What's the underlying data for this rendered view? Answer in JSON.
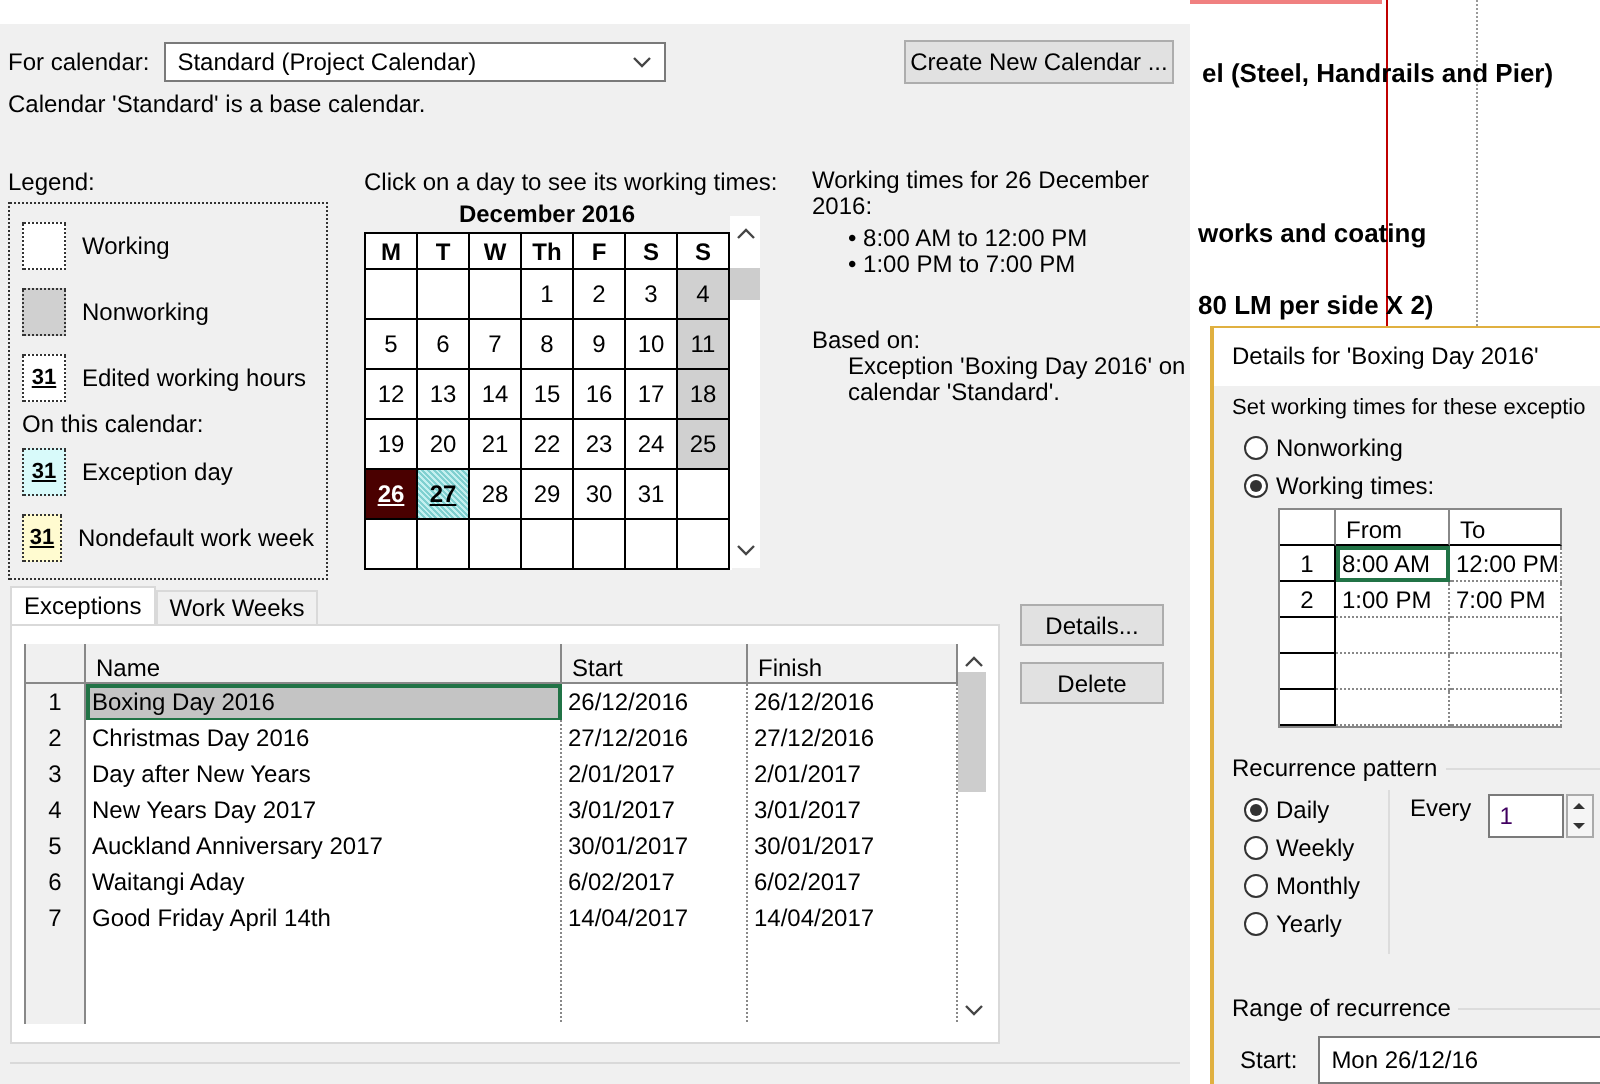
{
  "gantt_background": {
    "texts": [
      "el (Steel, Handrails and Pier)",
      "works and coating",
      "80 LM per side X 2)"
    ]
  },
  "calendar_dialog": {
    "calendar_label": "For calendar:",
    "calendar_value": "Standard (Project Calendar)",
    "create_button": "Create New Calendar ...",
    "base_note": "Calendar 'Standard' is a base calendar.",
    "legend": {
      "label": "Legend:",
      "items": [
        {
          "kind": "working",
          "label": "Working"
        },
        {
          "kind": "nonworking",
          "label": "Nonworking"
        },
        {
          "kind": "edited",
          "sample": "31",
          "label": "Edited working hours"
        }
      ],
      "section": "On this calendar:",
      "calendar_items": [
        {
          "kind": "exception",
          "sample": "31",
          "label": "Exception day"
        },
        {
          "kind": "nondefault",
          "sample": "31",
          "label": "Nondefault work week"
        }
      ]
    },
    "calendar": {
      "prompt": "Click on a day to see its working times:",
      "month": "December 2016",
      "weekdays": [
        "M",
        "T",
        "W",
        "Th",
        "F",
        "S",
        "S"
      ],
      "weeks": [
        [
          {
            "kind": "blank",
            "selected": false
          },
          {
            "kind": "blank",
            "selected": false
          },
          {
            "kind": "blank",
            "selected": false
          },
          {
            "day": "1",
            "kind": "working",
            "selected": false
          },
          {
            "day": "2",
            "kind": "working",
            "selected": false
          },
          {
            "day": "3",
            "kind": "working",
            "selected": false
          },
          {
            "day": "4",
            "kind": "nonworking",
            "selected": false
          }
        ],
        [
          {
            "day": "5",
            "kind": "working",
            "selected": false
          },
          {
            "day": "6",
            "kind": "working",
            "selected": false
          },
          {
            "day": "7",
            "kind": "working",
            "selected": false
          },
          {
            "day": "8",
            "kind": "working",
            "selected": false
          },
          {
            "day": "9",
            "kind": "working",
            "selected": false
          },
          {
            "day": "10",
            "kind": "working",
            "selected": false
          },
          {
            "day": "11",
            "kind": "nonworking",
            "selected": false
          }
        ],
        [
          {
            "day": "12",
            "kind": "working",
            "selected": false
          },
          {
            "day": "13",
            "kind": "working",
            "selected": false
          },
          {
            "day": "14",
            "kind": "working",
            "selected": false
          },
          {
            "day": "15",
            "kind": "working",
            "selected": false
          },
          {
            "day": "16",
            "kind": "working",
            "selected": false
          },
          {
            "day": "17",
            "kind": "working",
            "selected": false
          },
          {
            "day": "18",
            "kind": "nonworking",
            "selected": false
          }
        ],
        [
          {
            "day": "19",
            "kind": "working",
            "selected": false
          },
          {
            "day": "20",
            "kind": "working",
            "selected": false
          },
          {
            "day": "21",
            "kind": "working",
            "selected": false
          },
          {
            "day": "22",
            "kind": "working",
            "selected": false
          },
          {
            "day": "23",
            "kind": "working",
            "selected": false
          },
          {
            "day": "24",
            "kind": "working",
            "selected": false
          },
          {
            "day": "25",
            "kind": "nonworking",
            "selected": false
          }
        ],
        [
          {
            "day": "26",
            "kind": "exception",
            "selected": true
          },
          {
            "day": "27",
            "kind": "exception",
            "selected": false
          },
          {
            "day": "28",
            "kind": "working",
            "selected": false
          },
          {
            "day": "29",
            "kind": "working",
            "selected": false
          },
          {
            "day": "30",
            "kind": "working",
            "selected": false
          },
          {
            "day": "31",
            "kind": "working",
            "selected": false
          },
          {
            "kind": "blank",
            "selected": false
          }
        ],
        [
          {
            "kind": "blank",
            "selected": false
          },
          {
            "kind": "blank",
            "selected": false
          },
          {
            "kind": "blank",
            "selected": false
          },
          {
            "kind": "blank",
            "selected": false
          },
          {
            "kind": "blank",
            "selected": false
          },
          {
            "kind": "blank",
            "selected": false
          },
          {
            "kind": "blank",
            "selected": false
          }
        ]
      ]
    },
    "info": {
      "title": "Working times for 26 December 2016:",
      "times": [
        "• 8:00 AM to 12:00 PM",
        "• 1:00 PM to 7:00 PM"
      ],
      "based_label": "Based on:",
      "based_text": "Exception 'Boxing Day 2016' on calendar 'Standard'."
    },
    "tabs": [
      {
        "label": "Exceptions",
        "selected": true
      },
      {
        "label": "Work Weeks",
        "selected": false
      }
    ],
    "exceptions": {
      "columns": [
        "Name",
        "Start",
        "Finish"
      ],
      "rows": [
        {
          "num": "1",
          "name": "Boxing Day 2016",
          "start": "26/12/2016",
          "finish": "26/12/2016",
          "selected": true
        },
        {
          "num": "2",
          "name": "Christmas Day 2016",
          "start": "27/12/2016",
          "finish": "27/12/2016",
          "selected": false
        },
        {
          "num": "3",
          "name": "Day after New Years",
          "start": "2/01/2017",
          "finish": "2/01/2017",
          "selected": false
        },
        {
          "num": "4",
          "name": "New Years Day 2017",
          "start": "3/01/2017",
          "finish": "3/01/2017",
          "selected": false
        },
        {
          "num": "5",
          "name": "Auckland Anniversary 2017",
          "start": "30/01/2017",
          "finish": "30/01/2017",
          "selected": false
        },
        {
          "num": "6",
          "name": "Waitangi Aday",
          "start": "6/02/2017",
          "finish": "6/02/2017",
          "selected": false
        },
        {
          "num": "7",
          "name": "Good Friday April 14th",
          "start": "14/04/2017",
          "finish": "14/04/2017",
          "selected": false
        }
      ]
    },
    "buttons": [
      "Details...",
      "Delete"
    ]
  },
  "details_dialog": {
    "title": "Details for 'Boxing Day 2016'",
    "prompt": "Set working times for these exceptio",
    "modes": [
      {
        "label": "Nonworking",
        "selected": false
      },
      {
        "label": "Working times:",
        "selected": true
      }
    ],
    "times": {
      "columns": [
        "From",
        "To"
      ],
      "rows": [
        {
          "num": "1",
          "from": "8:00 AM",
          "to": "12:00 PM",
          "selected": true
        },
        {
          "num": "2",
          "from": "1:00 PM",
          "to": "7:00 PM",
          "selected": false
        }
      ]
    },
    "recurrence_label": "Recurrence pattern",
    "patterns": [
      {
        "label": "Daily",
        "selected": true
      },
      {
        "label": "Weekly",
        "selected": false
      },
      {
        "label": "Monthly",
        "selected": false
      },
      {
        "label": "Yearly",
        "selected": false
      }
    ],
    "every_label": "Every",
    "every_value": "1",
    "range_label": "Range of recurrence",
    "start_label": "Start:",
    "start_value": "Mon 26/12/16"
  }
}
